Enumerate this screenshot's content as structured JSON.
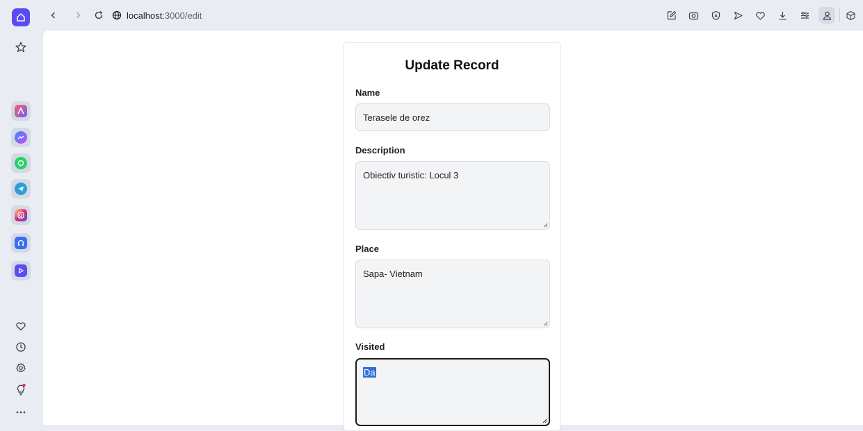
{
  "browser": {
    "url_host": "localhost",
    "url_path": ":3000/edit"
  },
  "form": {
    "title": "Update Record",
    "name_label": "Name",
    "name_value": "Terasele de orez",
    "description_label": "Description",
    "description_value": "Obiectiv turistic: Locul 3",
    "place_label": "Place",
    "place_value": "Sapa- Vietnam",
    "visited_label": "Visited",
    "visited_value": "Da"
  },
  "colors": {
    "accent": "#5b4bf3",
    "selection": "#2f6fd6"
  }
}
